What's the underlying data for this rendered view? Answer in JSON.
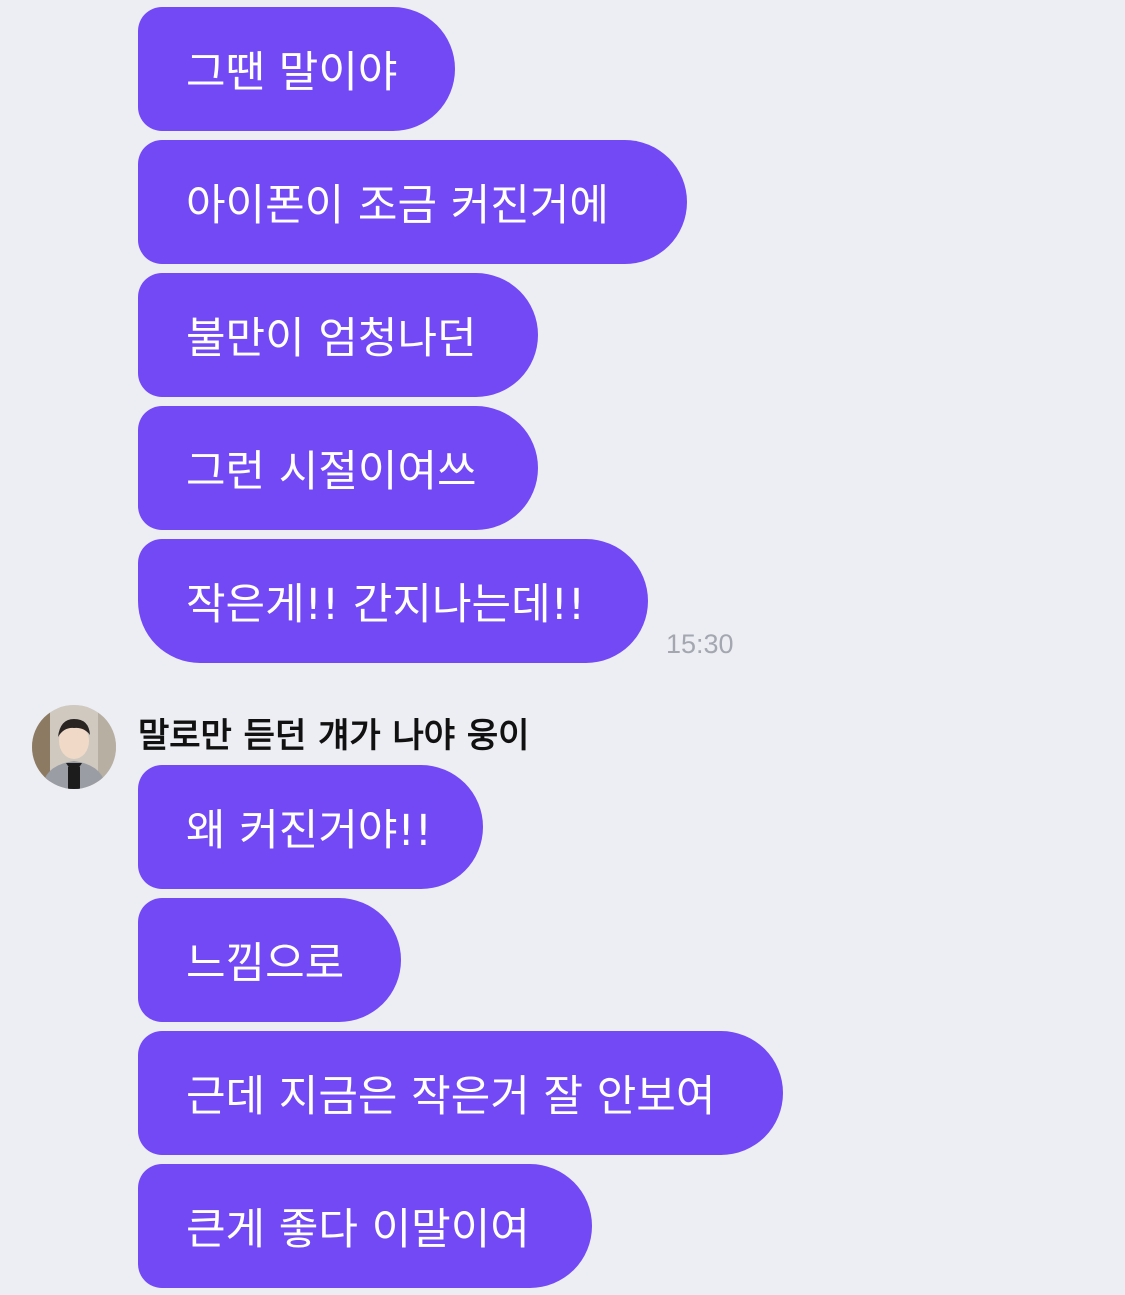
{
  "group1": {
    "messages": [
      "그땐 말이야",
      "아이폰이 조금 커진거에",
      "불만이 엄청나던",
      "그런 시절이여쓰",
      "작은게!! 간지나는데!!"
    ],
    "time": "15:30"
  },
  "group2": {
    "sender_name": "말로만 듣던 걔가 나야 웅이",
    "avatar_icon": "profile-photo",
    "messages": [
      "왜 커진거야!!",
      "느낌으로",
      "근데 지금은 작은거 잘 안보여",
      "큰게 좋다 이말이여"
    ]
  },
  "colors": {
    "bubble": "#7349f5",
    "background": "#edeef3",
    "timestamp": "#a4a7b0"
  }
}
